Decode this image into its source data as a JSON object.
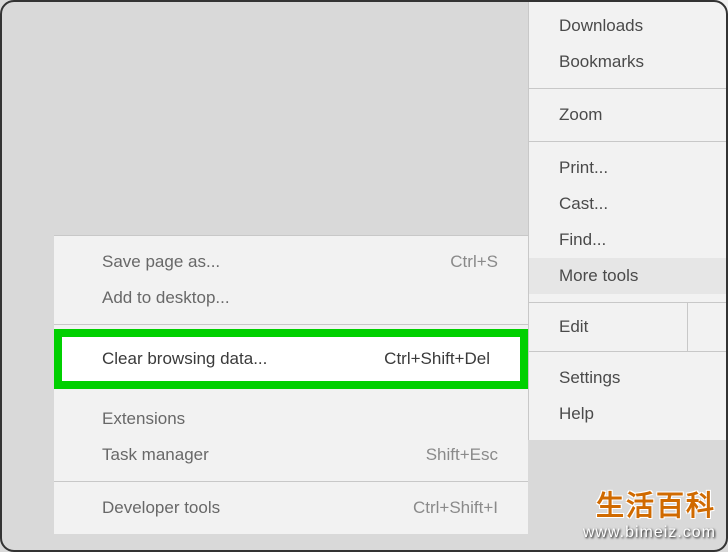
{
  "main_menu": {
    "downloads": "Downloads",
    "bookmarks": "Bookmarks",
    "zoom": "Zoom",
    "print": "Print...",
    "cast": "Cast...",
    "find": "Find...",
    "more_tools": "More tools",
    "edit": "Edit",
    "settings": "Settings",
    "help": "Help"
  },
  "submenu": {
    "save_page": {
      "label": "Save page as...",
      "shortcut": "Ctrl+S"
    },
    "add_desktop": {
      "label": "Add to desktop..."
    },
    "clear_browsing": {
      "label": "Clear browsing data...",
      "shortcut": "Ctrl+Shift+Del"
    },
    "extensions": {
      "label": "Extensions"
    },
    "task_manager": {
      "label": "Task manager",
      "shortcut": "Shift+Esc"
    },
    "developer_tools": {
      "label": "Developer tools",
      "shortcut": "Ctrl+Shift+I"
    }
  },
  "watermark": {
    "title": "生活百科",
    "url": "www.bimeiz.com"
  }
}
